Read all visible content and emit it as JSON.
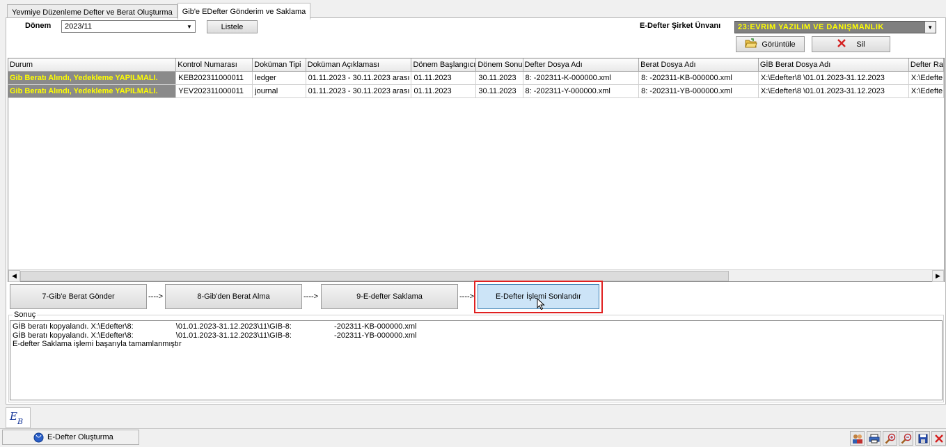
{
  "tabs": [
    {
      "label": "Yevmiye Düzenleme  Defter ve Berat Oluşturma"
    },
    {
      "label": "Gib'e EDefter Gönderim ve Saklama"
    }
  ],
  "period": {
    "label": "Dönem",
    "value": "2023/11"
  },
  "list_button": "Listele",
  "company": {
    "label": "E-Defter Şirket Ünvanı",
    "value": "23:EVRIM YAZILIM VE DANIŞMANLIK"
  },
  "view_button": "Görüntüle",
  "delete_button": "Sil",
  "grid": {
    "columns": [
      "Durum",
      "Kontrol Numarası",
      "Doküman Tipi",
      "Doküman Açıklaması",
      "Dönem Başlangıcı",
      "Dönem Sonu",
      "Defter Dosya Adı",
      "Berat Dosya Adı",
      "GİB Berat Dosya Adı",
      "Defter Ra"
    ],
    "rows": [
      [
        "Gib Beratı Alındı, Yedekleme YAPILMALI.",
        "KEB202311000011",
        "ledger",
        "01.11.2023 - 30.11.2023 arası",
        "01.11.2023",
        "30.11.2023",
        "8:                    -202311-K-000000.xml",
        "8:                    -202311-KB-000000.xml",
        "X:\\Edefter\\8                    \\01.01.2023-31.12.2023",
        "X:\\Edefte"
      ],
      [
        "Gib Beratı Alındı, Yedekleme YAPILMALI.",
        "YEV202311000011",
        "journal",
        "01.11.2023 - 30.11.2023 arası",
        "01.11.2023",
        "30.11.2023",
        "8:                    -202311-Y-000000.xml",
        "8:                    -202311-YB-000000.xml",
        "X:\\Edefter\\8                    \\01.01.2023-31.12.2023",
        "X:\\Edefte"
      ]
    ]
  },
  "steps": [
    {
      "label": "7-Gib'e Berat Gönder"
    },
    {
      "label": "8-Gib'den Berat Alma"
    },
    {
      "label": "9-E-defter Saklama"
    },
    {
      "label": "E-Defter İşlemi Sonlandır"
    }
  ],
  "step_arrow": "---->",
  "result": {
    "label": "Sonuç",
    "lines": [
      "GİB beratı kopyalandı. X:\\Edefter\\8:                    \\01.01.2023-31.12.2023\\11\\GIB-8:                    -202311-KB-000000.xml",
      "GİB beratı kopyalandı. X:\\Edefter\\8:                    \\01.01.2023-31.12.2023\\11\\GIB-8:                    -202311-YB-000000.xml",
      "E-defter Saklama işlemi başarıyla tamamlanmıştır"
    ]
  },
  "taskbar": {
    "app_label": "E-Defter Oluşturma"
  },
  "colors": {
    "status_bg": "#8a8a8a",
    "status_text": "#ffff00",
    "company_bg": "#808080",
    "company_text": "#ffff00",
    "highlight_border": "#e02020",
    "active_button": "#cce4f7"
  },
  "icons": [
    "folder-open-icon",
    "delete-x-icon",
    "eb-logo-icon",
    "app-globe-icon",
    "users-icon",
    "printer-icon",
    "zoom-in-icon",
    "zoom-out-icon",
    "save-icon",
    "close-icon"
  ]
}
